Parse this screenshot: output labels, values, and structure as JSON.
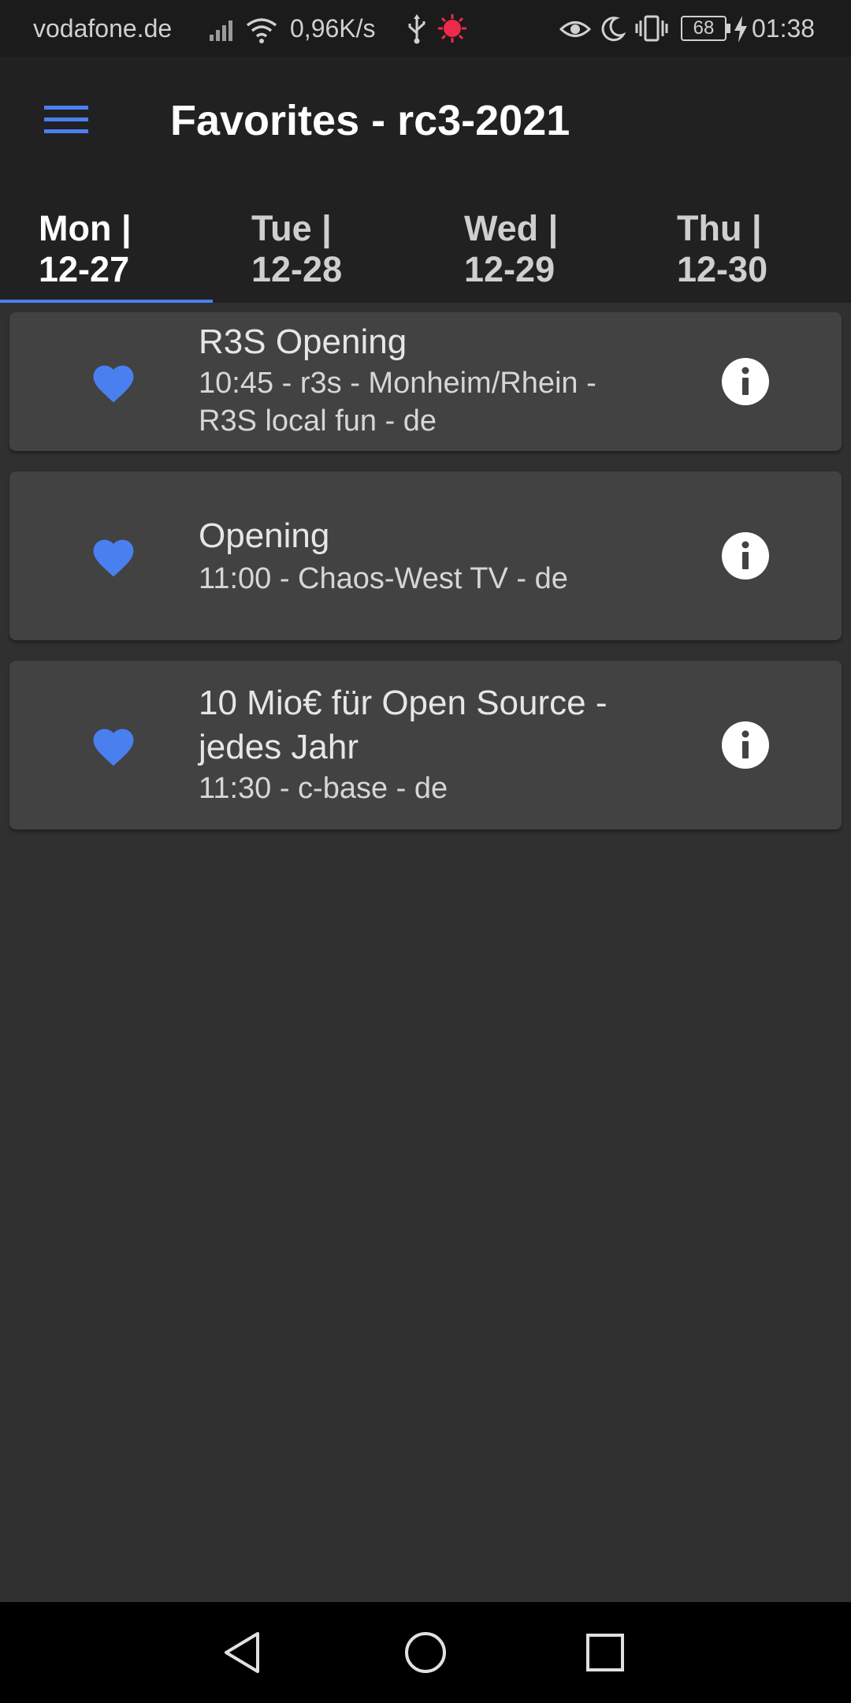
{
  "status_bar": {
    "carrier": "vodafone.de",
    "speed": "0,96K/s",
    "battery": "68",
    "time": "01:38"
  },
  "app_bar": {
    "title": "Favorites - rc3-2021",
    "menu_icon": "hamburger-menu-icon"
  },
  "tabs": [
    {
      "day": "Mon |",
      "date": "12-27",
      "active": true
    },
    {
      "day": "Tue |",
      "date": "12-28",
      "active": false
    },
    {
      "day": "Wed |",
      "date": "12-29",
      "active": false
    },
    {
      "day": "Thu |",
      "date": "12-30",
      "active": false
    }
  ],
  "events": [
    {
      "title": "R3S Opening",
      "subtitle_lines": [
        "10:45 - r3s - Monheim/Rhein -",
        "R3S local fun - de"
      ],
      "favorite": true
    },
    {
      "title": "Opening",
      "subtitle_lines": [
        "11:00 - Chaos-West TV - de"
      ],
      "favorite": true
    },
    {
      "title_lines": [
        "10 Mio€ für Open Source -",
        "jedes Jahr"
      ],
      "subtitle_lines": [
        "11:30 - c-base - de"
      ],
      "favorite": true
    }
  ],
  "colors": {
    "accent": "#4a7ff0",
    "background": "#303030",
    "card": "#424242",
    "app_bar": "#212121"
  },
  "icons": {
    "favorite": "heart-icon",
    "info": "info-icon",
    "nav_back": "back-triangle-icon",
    "nav_home": "home-circle-icon",
    "nav_recents": "recents-square-icon"
  }
}
